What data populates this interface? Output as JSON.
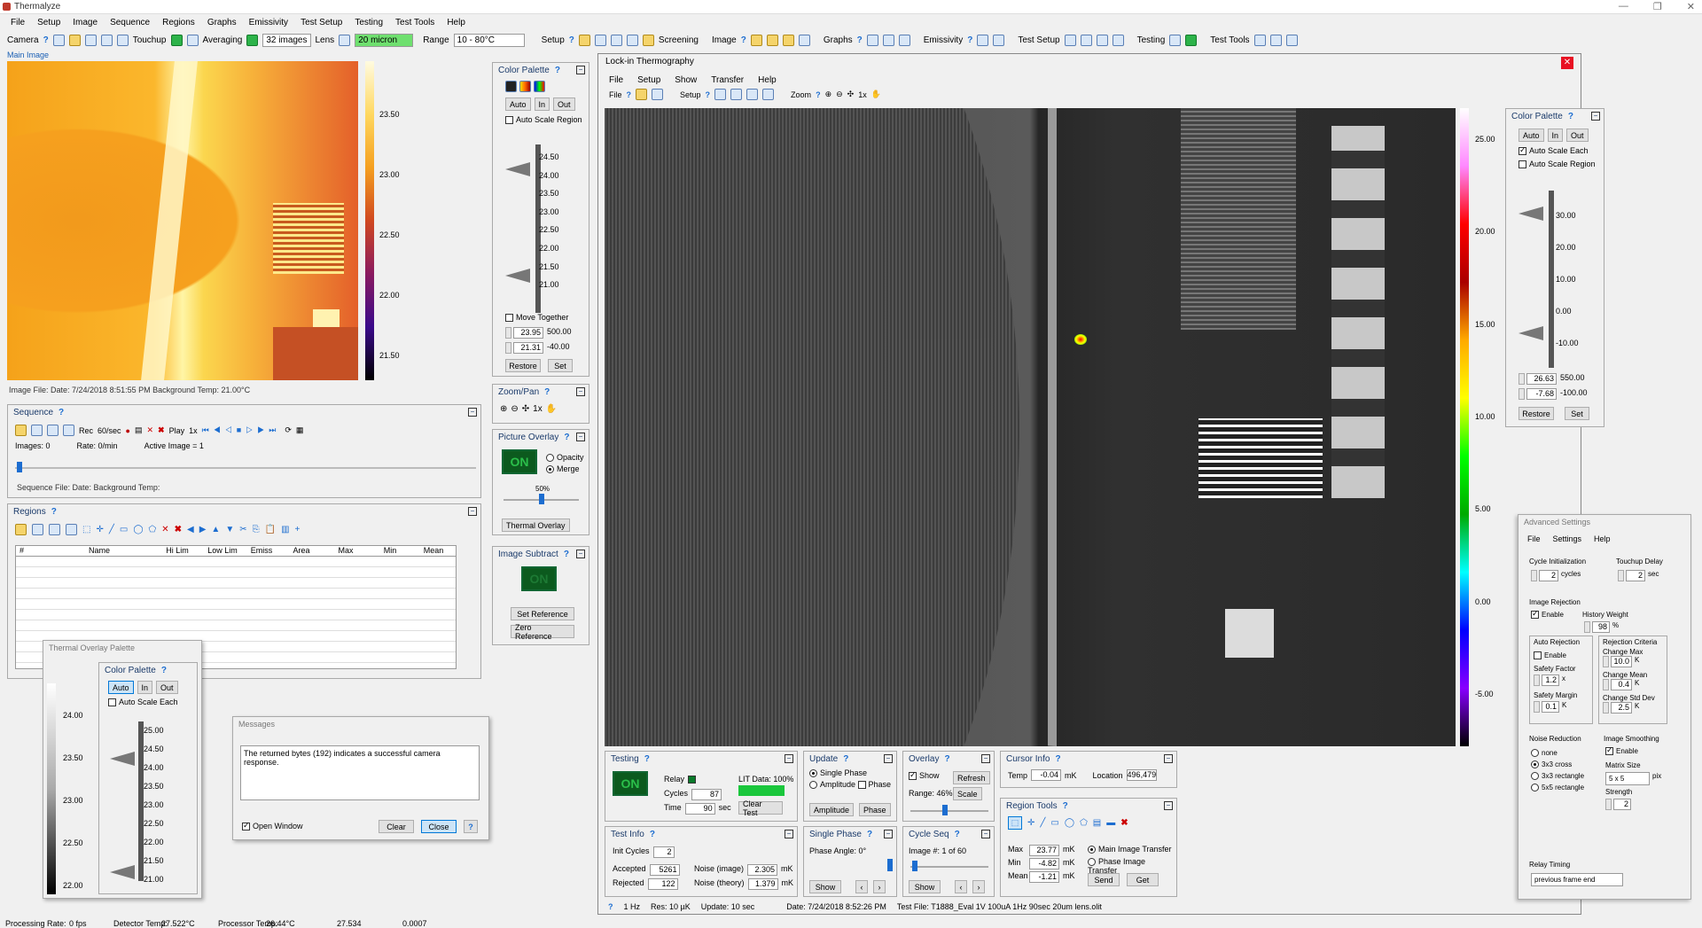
{
  "app": {
    "title": "Thermalyze"
  },
  "menu": [
    "File",
    "Setup",
    "Image",
    "Sequence",
    "Regions",
    "Graphs",
    "Emissivity",
    "Test Setup",
    "Testing",
    "Test Tools",
    "Help"
  ],
  "toolbar": {
    "camera": "Camera",
    "touchup": "Touchup",
    "averaging": "Averaging",
    "avg_value": "32 images",
    "lens": "Lens",
    "lens_value": "20 micron",
    "range": "Range",
    "range_value": "10 - 80°C",
    "setup": "Setup",
    "screening": "Screening",
    "image": "Image",
    "graphs": "Graphs",
    "emissivity": "Emissivity",
    "test_setup": "Test Setup",
    "testing": "Testing",
    "test_tools": "Test Tools"
  },
  "main_image": {
    "label": "Main Image",
    "scale": [
      "23.50",
      "23.00",
      "22.50",
      "22.00",
      "21.50"
    ],
    "info": "Image File:  Date:  7/24/2018 8:51:55 PM   Background Temp: 21.00°C"
  },
  "color_palette": {
    "title": "Color Palette",
    "auto": "Auto",
    "in": "In",
    "out": "Out",
    "auto_scale_region": "Auto Scale Region",
    "ticks": [
      "24.50",
      "24.00",
      "23.50",
      "23.00",
      "22.50",
      "22.00",
      "21.50",
      "21.00"
    ],
    "move_together": "Move Together",
    "upper": "23.95",
    "upper2": "500.00",
    "lower": "21.31",
    "lower2": "-40.00",
    "restore": "Restore",
    "set": "Set"
  },
  "zoom_pan": {
    "title": "Zoom/Pan",
    "zoom": "1x"
  },
  "picture_overlay": {
    "title": "Picture Overlay",
    "on": "ON",
    "opacity": "Opacity",
    "merge": "Merge",
    "pct": "50%",
    "thermal_overlay": "Thermal Overlay"
  },
  "image_subtract": {
    "title": "Image Subtract",
    "on": "ON",
    "set_ref": "Set Reference",
    "zero_ref": "Zero Reference"
  },
  "sequence": {
    "title": "Sequence",
    "rec": "Rec",
    "rate_val": "60/sec",
    "play": "Play",
    "play_rate": "1x",
    "images": "Images: 0",
    "rate": "Rate: 0/min",
    "active": "Active Image = 1",
    "file": "Sequence File:  Date:   Background Temp:"
  },
  "regions": {
    "title": "Regions",
    "columns": [
      "#",
      "Name",
      "Hi Lim",
      "Low Lim",
      "Emiss",
      "Area",
      "Max",
      "Min",
      "Mean"
    ]
  },
  "overlay_palette": {
    "title": "Thermal Overlay Palette",
    "cp_title": "Color Palette",
    "auto": "Auto",
    "in": "In",
    "out": "Out",
    "auto_each": "Auto Scale Each",
    "left_ticks": [
      "24.00",
      "23.50",
      "23.00",
      "22.50",
      "22.00"
    ],
    "ticks": [
      "25.00",
      "24.50",
      "24.00",
      "23.50",
      "23.00",
      "22.50",
      "22.00",
      "21.50",
      "21.00"
    ]
  },
  "messages": {
    "title": "Messages",
    "text": "The returned bytes (192) indicates a successful camera response.",
    "open_window": "Open Window",
    "clear": "Clear",
    "close": "Close"
  },
  "lit": {
    "title": "Lock-in Thermography",
    "menu": [
      "File",
      "Setup",
      "Show",
      "Transfer",
      "Help"
    ],
    "tb_file": "File",
    "tb_setup": "Setup",
    "tb_zoom": "Zoom",
    "zoom": "1x",
    "scale": [
      "25.00",
      "20.00",
      "15.00",
      "10.00",
      "5.00",
      "0.00",
      "-5.00"
    ]
  },
  "lit_palette": {
    "title": "Color Palette",
    "auto": "Auto",
    "in": "In",
    "out": "Out",
    "auto_each": "Auto Scale Each",
    "auto_region": "Auto Scale Region",
    "ticks": [
      "30.00",
      "20.00",
      "10.00",
      "0.00",
      "-10.00"
    ],
    "upper": "26.63",
    "upper2": "550.00",
    "lower": "-7.68",
    "lower2": "-100.00",
    "restore": "Restore",
    "set": "Set"
  },
  "testing": {
    "title": "Testing",
    "on": "ON",
    "relay": "Relay",
    "cycles_label": "Cycles",
    "cycles": "87",
    "time_label": "Time",
    "time": "90",
    "sec": "sec",
    "lit_data": "LIT Data: 100%",
    "clear_test": "Clear Test"
  },
  "update": {
    "title": "Update",
    "single_phase": "Single Phase",
    "amplitude": "Amplitude",
    "phase": "Phase",
    "amp_btn": "Amplitude",
    "phase_btn": "Phase"
  },
  "overlay": {
    "title": "Overlay",
    "show": "Show",
    "refresh": "Refresh",
    "range": "Range: 46%",
    "scale": "Scale"
  },
  "cursor": {
    "title": "Cursor Info",
    "temp_label": "Temp",
    "temp": "-0.04",
    "mk": "mK",
    "loc_label": "Location",
    "loc": "496,479"
  },
  "test_info": {
    "title": "Test Info",
    "init_label": "Init Cycles",
    "init": "2",
    "accepted_label": "Accepted",
    "accepted": "5261",
    "rejected_label": "Rejected",
    "rejected": "122",
    "noise_img_label": "Noise (image)",
    "noise_img": "2.305",
    "noise_th_label": "Noise (theory)",
    "noise_th": "1.379",
    "mk": "mK"
  },
  "single_phase": {
    "title": "Single Phase",
    "angle": "Phase Angle: 0°",
    "show": "Show"
  },
  "cycle_seq": {
    "title": "Cycle Seq",
    "image": "Image #: 1 of 60",
    "show": "Show"
  },
  "region_tools": {
    "title": "Region Tools",
    "max_l": "Max",
    "max": "23.77",
    "min_l": "Min",
    "min": "-4.82",
    "mean_l": "Mean",
    "mean": "-1.21",
    "mk": "mK",
    "main_transfer": "Main Image Transfer",
    "phase_transfer": "Phase Image Transfer",
    "send": "Send",
    "get": "Get"
  },
  "lit_status": {
    "freq": "1 Hz",
    "res": "Res: 10 µK",
    "update": "Update: 10 sec",
    "date": "Date: 7/24/2018 8:52:26 PM",
    "file": "Test File: T1888_Eval 1V 100uA 1Hz 90sec 20um lens.olit"
  },
  "adv": {
    "title": "Advanced Settings",
    "menu": [
      "File",
      "Settings",
      "Help"
    ],
    "cycle_init": "Cycle Initialization",
    "cycle_val": "2",
    "cycles": "cycles",
    "touchup_delay": "Touchup Delay",
    "td_val": "2",
    "sec": "sec",
    "image_rej": "Image Rejection",
    "enable": "Enable",
    "history": "History Weight",
    "hist_val": "98",
    "pct": "%",
    "auto_rej": "Auto Rejection",
    "rej_crit": "Rejection Criteria",
    "change_max": "Change Max",
    "cm_val": "10.0",
    "k": "K",
    "safety_factor": "Safety Factor",
    "sf_val": "1.2",
    "x": "x",
    "change_mean": "Change Mean",
    "cmean_val": "0.4",
    "safety_margin": "Safety Margin",
    "sm_val": "0.1",
    "change_std": "Change Std Dev",
    "cs_val": "2.5",
    "noise_red": "Noise Reduction",
    "none": "none",
    "c3": "3x3 cross",
    "r3": "3x3 rectangle",
    "r5": "5x5 rectangle",
    "img_smooth": "Image Smoothing",
    "matrix": "Matrix Size",
    "matrix_val": "5 x 5",
    "pix": "pix",
    "strength": "Strength",
    "str_val": "2",
    "relay_timing": "Relay Timing",
    "relay_val": "previous frame end"
  },
  "status": {
    "proc_rate": "Processing Rate:",
    "fps": "0 fps",
    "det_temp": "Detector Temp:",
    "det_val": "27.522°C",
    "proc_temp": "Processor Temp:",
    "proc_val": "26.44°C",
    "v1": "27.534",
    "v2": "0.0007"
  }
}
